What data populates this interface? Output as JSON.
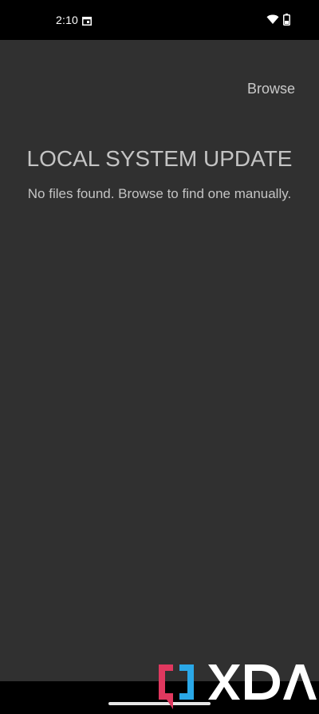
{
  "status_bar": {
    "time": "2:10",
    "icons": [
      "calendar-icon",
      "wifi-icon",
      "battery-icon"
    ]
  },
  "app": {
    "browse_label": "Browse",
    "title": "LOCAL SYSTEM UPDATE",
    "message": "No files found. Browse to find one manually."
  },
  "watermark": {
    "text": "XDA",
    "colors": {
      "bracket_left": "#e0385f",
      "bracket_right": "#2aa8e8",
      "text": "#ffffff"
    }
  },
  "colors": {
    "background": "#303030",
    "text": "#c4c4c4",
    "status_bar": "#000000"
  }
}
